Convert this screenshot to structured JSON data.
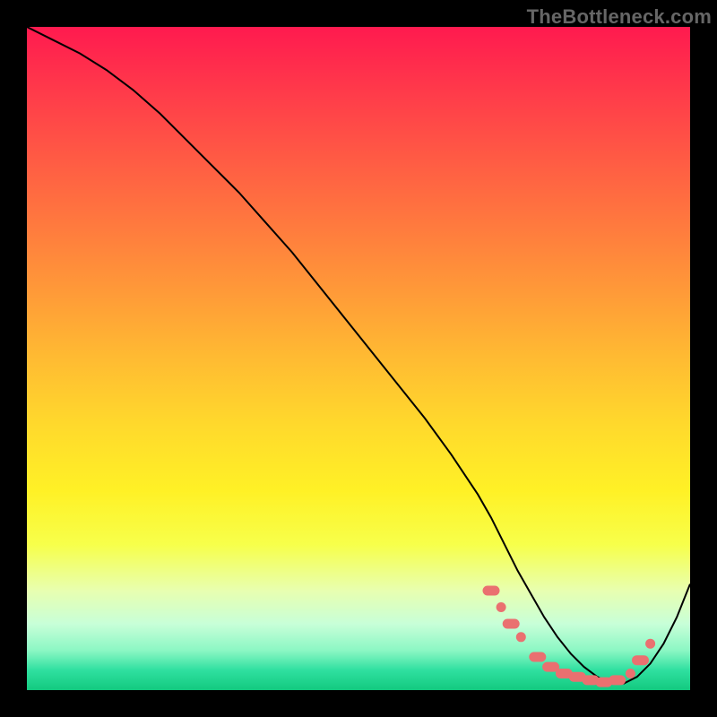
{
  "watermark": "TheBottleneck.com",
  "colors": {
    "frame": "#000000",
    "curve": "#000000",
    "marker": "#ea7070",
    "gradient_stops": [
      "#ff1a4f",
      "#ff3b4a",
      "#ff5b44",
      "#ff7a3e",
      "#ff9a38",
      "#ffbb32",
      "#ffd92c",
      "#fff126",
      "#f7ff4a",
      "#e8ffb0",
      "#c8ffd8",
      "#8cf7c4",
      "#2fe0a0",
      "#13c97f"
    ]
  },
  "chart_data": {
    "type": "line",
    "title": "",
    "xlabel": "",
    "ylabel": "",
    "x_range": [
      0,
      100
    ],
    "y_range": [
      0,
      100
    ],
    "grid": false,
    "legend": false,
    "series": [
      {
        "name": "bottleneck-curve",
        "x": [
          0,
          4,
          8,
          12,
          16,
          20,
          24,
          28,
          32,
          36,
          40,
          44,
          48,
          52,
          56,
          60,
          64,
          68,
          70,
          72,
          74,
          76,
          78,
          80,
          82,
          84,
          86,
          88,
          90,
          92,
          94,
          96,
          98,
          100
        ],
        "y": [
          100,
          98,
          96,
          93.5,
          90.5,
          87,
          83,
          79,
          75,
          70.5,
          66,
          61,
          56,
          51,
          46,
          41,
          35.5,
          29.5,
          26,
          22,
          18,
          14.5,
          11,
          8,
          5.5,
          3.5,
          2,
          1,
          1,
          2,
          4,
          7,
          11,
          16
        ]
      }
    ],
    "markers": [
      {
        "x": 70.0,
        "y": 15.0,
        "shape": "pill"
      },
      {
        "x": 71.5,
        "y": 12.5,
        "shape": "dot"
      },
      {
        "x": 73.0,
        "y": 10.0,
        "shape": "pill"
      },
      {
        "x": 74.5,
        "y": 8.0,
        "shape": "dot"
      },
      {
        "x": 77.0,
        "y": 5.0,
        "shape": "pill"
      },
      {
        "x": 79.0,
        "y": 3.5,
        "shape": "pill"
      },
      {
        "x": 81.0,
        "y": 2.5,
        "shape": "pill"
      },
      {
        "x": 83.0,
        "y": 2.0,
        "shape": "pill"
      },
      {
        "x": 85.0,
        "y": 1.5,
        "shape": "pill"
      },
      {
        "x": 87.0,
        "y": 1.2,
        "shape": "pill"
      },
      {
        "x": 89.0,
        "y": 1.5,
        "shape": "pill"
      },
      {
        "x": 91.0,
        "y": 2.5,
        "shape": "dot"
      },
      {
        "x": 92.5,
        "y": 4.5,
        "shape": "pill"
      },
      {
        "x": 94.0,
        "y": 7.0,
        "shape": "dot"
      }
    ]
  }
}
